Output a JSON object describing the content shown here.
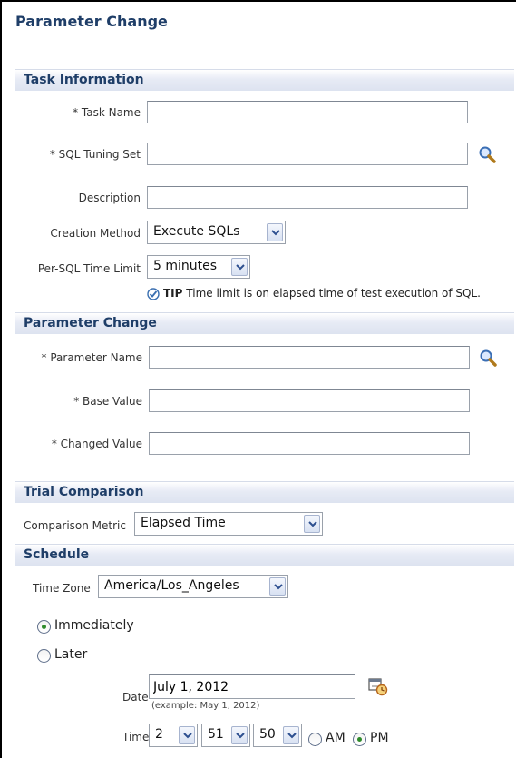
{
  "page": {
    "title": "Parameter Change"
  },
  "task_info": {
    "heading": "Task Information",
    "task_name": {
      "label": "* Task Name",
      "value": ""
    },
    "sql_tuning_set": {
      "label": "* SQL Tuning Set",
      "value": ""
    },
    "description": {
      "label": "Description",
      "value": ""
    },
    "creation_method": {
      "label": "Creation Method",
      "selected": "Execute SQLs"
    },
    "time_limit": {
      "label": "Per-SQL Time Limit",
      "selected": "5 minutes"
    },
    "tip": {
      "prefix": "TIP",
      "text": "Time limit is on elapsed time of test execution of SQL."
    }
  },
  "param_change": {
    "heading": "Parameter Change",
    "parameter_name": {
      "label": "* Parameter Name",
      "value": ""
    },
    "base_value": {
      "label": "* Base Value",
      "value": ""
    },
    "changed_value": {
      "label": "* Changed Value",
      "value": ""
    }
  },
  "trial": {
    "heading": "Trial Comparison",
    "metric": {
      "label": "Comparison Metric",
      "selected": "Elapsed Time"
    }
  },
  "schedule": {
    "heading": "Schedule",
    "time_zone": {
      "label": "Time Zone",
      "selected": "America/Los_Angeles"
    },
    "immediately": {
      "label": "Immediately",
      "checked": true
    },
    "later": {
      "label": "Later",
      "checked": false
    },
    "date": {
      "label": "Date",
      "value": "July 1, 2012",
      "hint": "(example: May 1, 2012)"
    },
    "time": {
      "label": "Time",
      "hour": "2",
      "minute": "51",
      "second": "50",
      "am_label": "AM",
      "pm_label": "PM",
      "meridiem": "PM"
    }
  },
  "icons": {
    "search": "magnifying-glass",
    "calendar": "calendar-clock",
    "tip": "checkmark-circle"
  },
  "colors": {
    "heading": "#1f3e68",
    "section_bg": "#e7ebf5",
    "radio_checked": "#2e8a2b"
  }
}
